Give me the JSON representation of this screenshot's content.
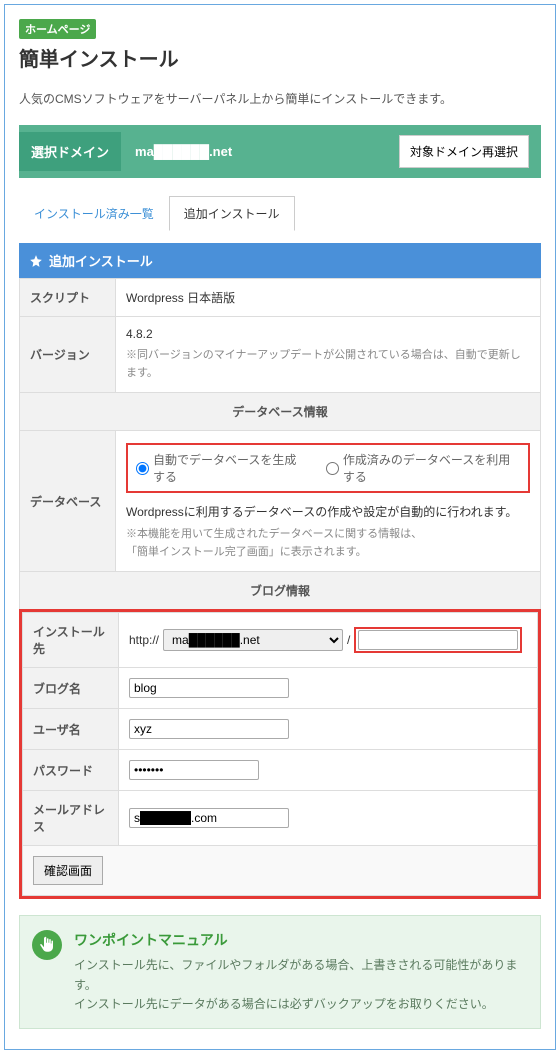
{
  "header": {
    "badge": "ホームページ",
    "title": "簡単インストール",
    "intro": "人気のCMSソフトウェアをサーバーパネル上から簡単にインストールできます。"
  },
  "domain": {
    "label": "選択ドメイン",
    "name": "ma██████.net",
    "reselect": "対象ドメイン再選択"
  },
  "tabs": {
    "installed": "インストール済み一覧",
    "add": "追加インストール"
  },
  "section": {
    "title": "追加インストール"
  },
  "rows": {
    "script_label": "スクリプト",
    "script_value": "Wordpress 日本語版",
    "version_label": "バージョン",
    "version_value": "4.8.2",
    "version_note": "※同バージョンのマイナーアップデートが公開されている場合は、自動で更新します。",
    "db_header": "データベース情報",
    "db_label": "データベース",
    "db_radio_auto": "自動でデータベースを生成する",
    "db_radio_existing": "作成済みのデータベースを利用する",
    "db_desc": "Wordpressに利用するデータベースの作成や設定が自動的に行われます。",
    "db_note": "※本機能を用いて生成されたデータベースに関する情報は、\n「簡単インストール完了画面」に表示されます。",
    "blog_header": "ブログ情報",
    "install_label": "インストール先",
    "install_proto": "http://",
    "install_domain": "ma██████.net",
    "install_slash": "/",
    "install_path": "",
    "blogname_label": "ブログ名",
    "blogname_value": "blog",
    "user_label": "ユーザ名",
    "user_value": "xyz",
    "pass_label": "パスワード",
    "pass_value": "●●●●●●●",
    "mail_label": "メールアドレス",
    "mail_value": "s██████.com",
    "confirm": "確認画面"
  },
  "tip": {
    "title": "ワンポイントマニュアル",
    "text": "インストール先に、ファイルやフォルダがある場合、上書きされる可能性があります。\nインストール先にデータがある場合には必ずバックアップをお取りください。"
  }
}
